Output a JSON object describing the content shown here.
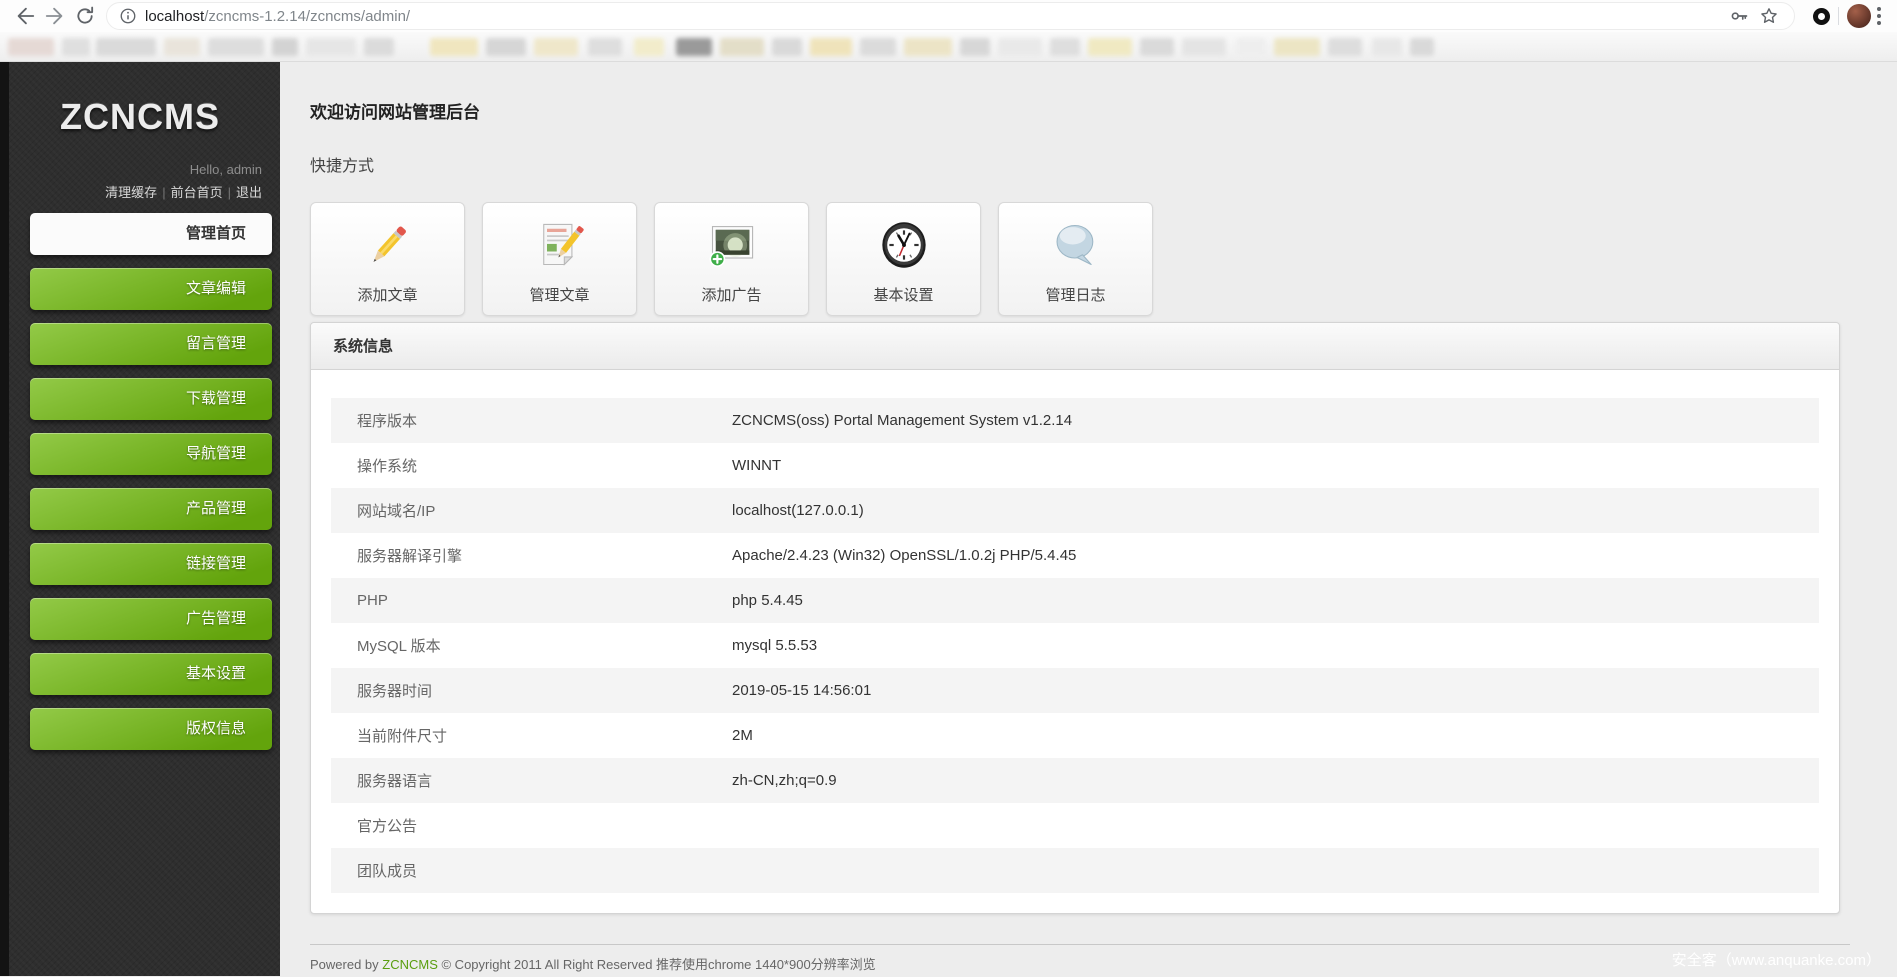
{
  "browser": {
    "url": {
      "host": "localhost",
      "path": "/zcncms-1.2.14/zcncms/admin/"
    }
  },
  "sidebar": {
    "logo": "ZCNCMS",
    "greeting": "Hello, admin",
    "links": [
      {
        "name": "clear-cache",
        "label": "清理缓存"
      },
      {
        "name": "site-front-home",
        "label": "前台首页"
      },
      {
        "name": "logout",
        "label": "退出"
      }
    ],
    "menu": [
      {
        "name": "admin-home",
        "label": "管理首页",
        "active": true
      },
      {
        "name": "article-edit",
        "label": "文章编辑",
        "active": false
      },
      {
        "name": "message-management",
        "label": "留言管理",
        "active": false
      },
      {
        "name": "download-management",
        "label": "下载管理",
        "active": false
      },
      {
        "name": "nav-management",
        "label": "导航管理",
        "active": false
      },
      {
        "name": "product-management",
        "label": "产品管理",
        "active": false
      },
      {
        "name": "link-management",
        "label": "链接管理",
        "active": false
      },
      {
        "name": "ad-management",
        "label": "广告管理",
        "active": false
      },
      {
        "name": "basic-settings",
        "label": "基本设置",
        "active": false
      },
      {
        "name": "copyright-info",
        "label": "版权信息",
        "active": false
      }
    ]
  },
  "main": {
    "welcome_title": "欢迎访问网站管理后台",
    "shortcuts_title": "快捷方式",
    "shortcuts": [
      {
        "name": "add-article",
        "label": "添加文章",
        "icon": "pencil-icon"
      },
      {
        "name": "manage-article",
        "label": "管理文章",
        "icon": "document-pencil-icon"
      },
      {
        "name": "add-ad",
        "label": "添加广告",
        "icon": "image-plus-icon"
      },
      {
        "name": "basic-settings",
        "label": "基本设置",
        "icon": "clock-icon"
      },
      {
        "name": "manage-log",
        "label": "管理日志",
        "icon": "speech-bubble-icon"
      }
    ],
    "system_info": {
      "title": "系统信息",
      "rows": [
        {
          "label": "程序版本",
          "value": "ZCNCMS(oss) Portal Management System v1.2.14"
        },
        {
          "label": "操作系统",
          "value": "WINNT"
        },
        {
          "label": "网站域名/IP",
          "value": "localhost(127.0.0.1)"
        },
        {
          "label": "服务器解译引擎",
          "value": "Apache/2.4.23 (Win32) OpenSSL/1.0.2j PHP/5.4.45"
        },
        {
          "label": "PHP",
          "value": "php 5.4.45"
        },
        {
          "label": "MySQL 版本",
          "value": "mysql 5.5.53"
        },
        {
          "label": "服务器时间",
          "value": "2019-05-15 14:56:01"
        },
        {
          "label": "当前附件尺寸",
          "value": "2M"
        },
        {
          "label": "服务器语言",
          "value": "zh-CN,zh;q=0.9"
        },
        {
          "label": "官方公告",
          "value": ""
        },
        {
          "label": "团队成员",
          "value": ""
        }
      ]
    },
    "footer": {
      "powered_prefix": "Powered by ",
      "brand": "ZCNCMS",
      "powered_suffix": " © Copyright 2011 All Right Reserved 推荐使用chrome 1440*900分辨率浏览"
    }
  },
  "watermark": "安全客（www.anquanke.com）",
  "colors": {
    "accent_green": "#6cab10",
    "sidebar_bg": "#2e2e2e",
    "brand_link_green": "#5a9e0f",
    "active_item_bg": "#fbfbfb"
  }
}
